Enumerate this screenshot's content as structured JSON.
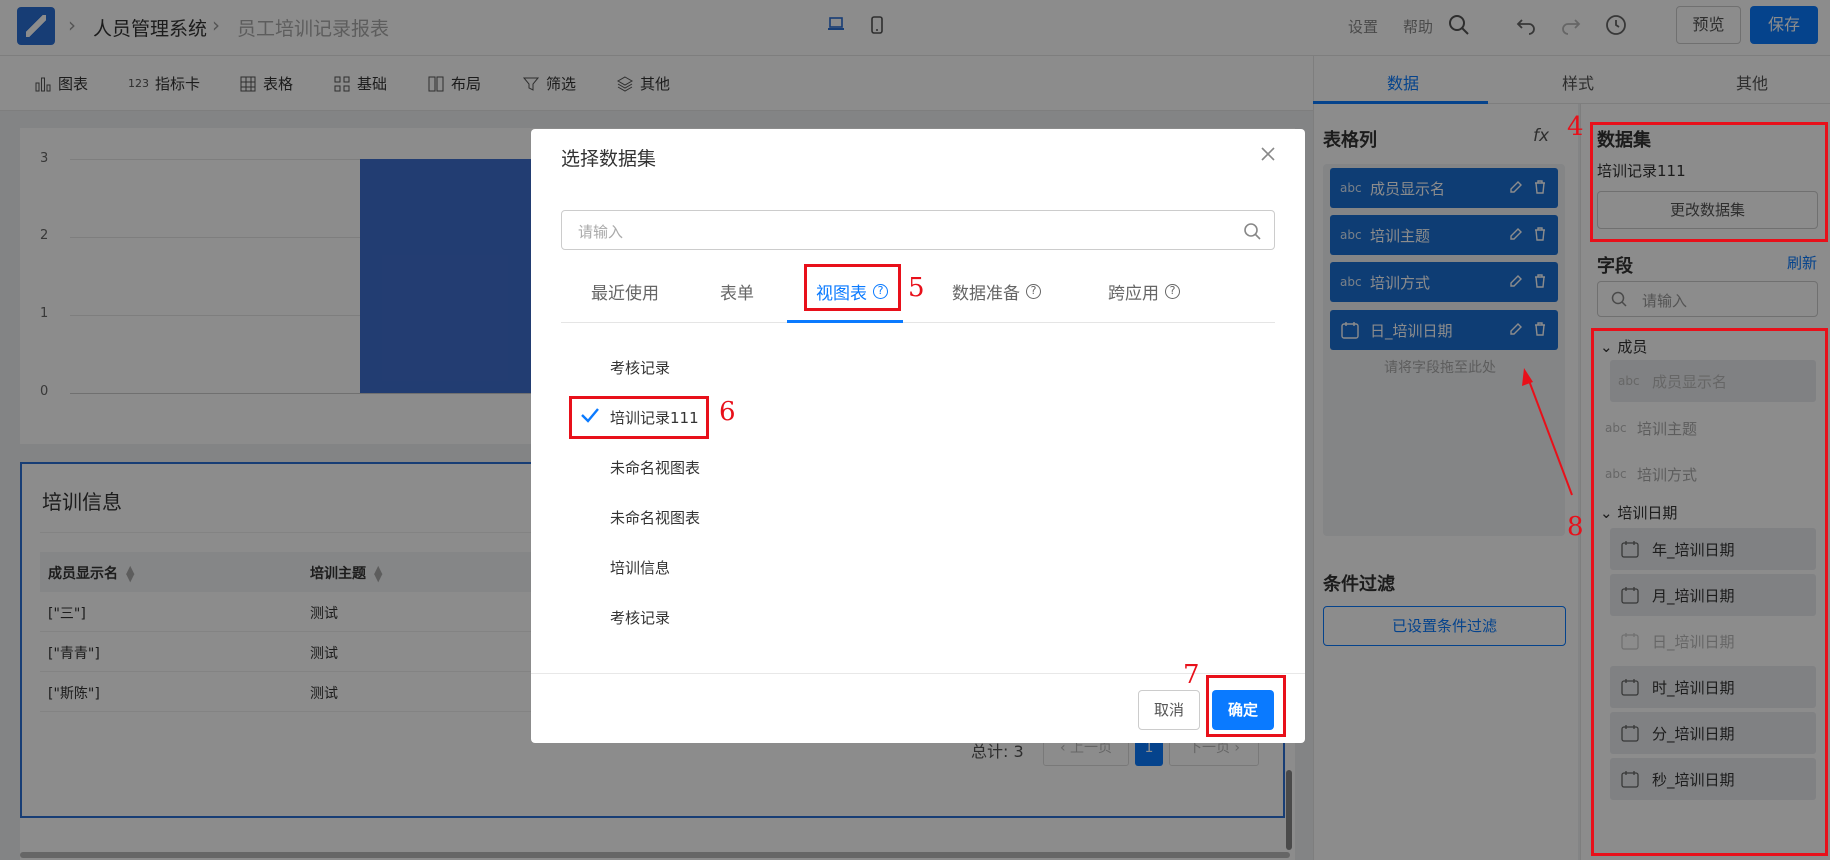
{
  "header": {
    "crumb_system": "人员管理系统",
    "crumb_page": "员工培训记录报表",
    "settings": "设置",
    "help": "帮助",
    "preview": "预览",
    "save": "保存"
  },
  "toolbar": {
    "items": [
      "图表",
      "指标卡",
      "表格",
      "基础",
      "布局",
      "筛选",
      "其他"
    ]
  },
  "chart_data": {
    "type": "bar",
    "yticks": [
      "3",
      "2",
      "1",
      "0"
    ],
    "ylim": [
      0,
      3
    ],
    "values": [
      3
    ]
  },
  "table_card": {
    "title": "培训信息",
    "columns": [
      "成员显示名",
      "培训主题"
    ],
    "rows": [
      [
        "[\"三\"]",
        "测试"
      ],
      [
        "[\"青青\"]",
        "测试"
      ],
      [
        "[\"斯陈\"]",
        "测试"
      ]
    ],
    "total": "总计: 3",
    "prev": "上一页",
    "current_page": "1",
    "next": "下一页"
  },
  "right_tabs": [
    "数据",
    "样式",
    "其他"
  ],
  "columns_panel": {
    "title": "表格列",
    "fx": "fx",
    "items": [
      {
        "type": "abc",
        "label": "成员显示名"
      },
      {
        "type": "abc",
        "label": "培训主题"
      },
      {
        "type": "abc",
        "label": "培训方式"
      },
      {
        "type": "date",
        "label": "日_培训日期"
      }
    ],
    "drop_hint": "请将字段拖至此处",
    "filter_title": "条件过滤",
    "filter_button": "已设置条件过滤"
  },
  "dataset_panel": {
    "title": "数据集",
    "name": "培训记录111",
    "change_button": "更改数据集",
    "fields_title": "字段",
    "refresh": "刷新",
    "search_placeholder": "请输入",
    "group_member": "成员",
    "member_field": "成员显示名",
    "plain_fields": [
      "培训主题",
      "培训方式"
    ],
    "group_date": "培训日期",
    "date_fields": [
      "年_培训日期",
      "月_培训日期",
      "日_培训日期",
      "时_培训日期",
      "分_培训日期",
      "秒_培训日期"
    ]
  },
  "modal": {
    "title": "选择数据集",
    "search_placeholder": "请输入",
    "tabs": [
      "最近使用",
      "表单",
      "视图表",
      "数据准备",
      "跨应用"
    ],
    "items": [
      "考核记录",
      "培训记录111",
      "未命名视图表",
      "未命名视图表",
      "培训信息",
      "考核记录"
    ],
    "cancel": "取消",
    "ok": "确定"
  },
  "annotations": [
    "4",
    "5",
    "6",
    "7",
    "8"
  ],
  "colors": {
    "accent": "#0a7aff",
    "bar": "#3f6fd0",
    "annotation": "#e8101a"
  }
}
